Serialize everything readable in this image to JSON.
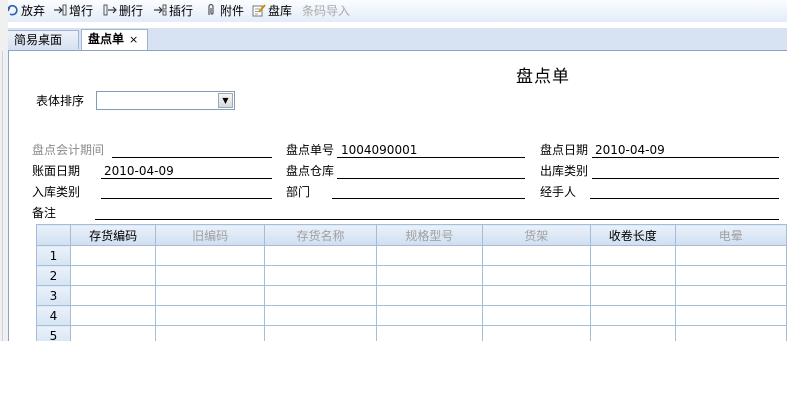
{
  "toolbar": {
    "items": [
      {
        "label": "放弃",
        "icon": "undo-icon"
      },
      {
        "label": "增行",
        "icon": "add-row-icon"
      },
      {
        "label": "删行",
        "icon": "delete-row-icon"
      },
      {
        "label": "插行",
        "icon": "insert-row-icon"
      },
      {
        "label": "附件",
        "icon": "paperclip-icon"
      },
      {
        "label": "盘库",
        "icon": "inventory-icon"
      },
      {
        "label": "条码导入",
        "icon": "",
        "disabled": true
      }
    ]
  },
  "tabs": [
    {
      "label": "简易桌面",
      "active": false
    },
    {
      "label": "盘点单",
      "active": true,
      "close": "×"
    }
  ],
  "form": {
    "title": "盘点单",
    "sort_label": "表体排序",
    "sort_value": "",
    "fields": {
      "period_label": "盘点会计期间",
      "period_value": "",
      "number_label": "盘点单号",
      "number_value": "1004090001",
      "date_label": "盘点日期",
      "date_value": "2010-04-09",
      "book_date_label": "账面日期",
      "book_date_value": "2010-04-09",
      "warehouse_label": "盘点仓库",
      "warehouse_value": "",
      "out_type_label": "出库类别",
      "out_type_value": "",
      "in_type_label": "入库类别",
      "in_type_value": "",
      "dept_label": "部门",
      "dept_value": "",
      "handler_label": "经手人",
      "handler_value": "",
      "remark_label": "备注",
      "remark_value": ""
    }
  },
  "grid": {
    "columns": [
      "存货编码",
      "旧编码",
      "存货名称",
      "规格型号",
      "货架",
      "收卷长度",
      "电晕"
    ],
    "rows": [
      "1",
      "2",
      "3",
      "4",
      "5"
    ]
  }
}
